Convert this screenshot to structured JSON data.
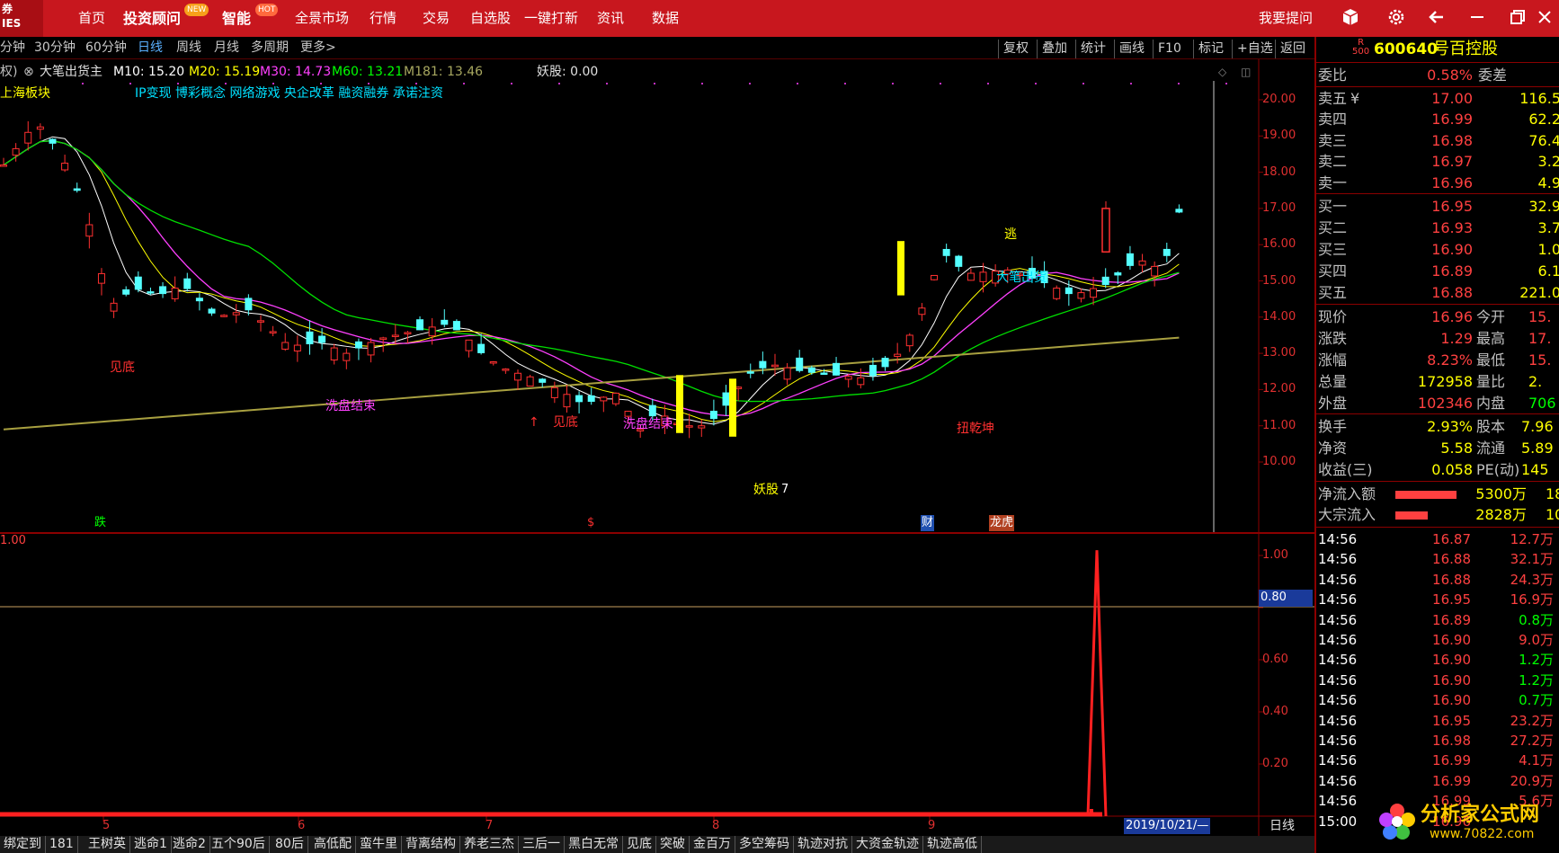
{
  "app": {
    "logo_text": "券\nIES",
    "nav": [
      "首页",
      "投资顾问",
      "智能",
      "全景市场",
      "行情",
      "交易",
      "自选股",
      "一键打新",
      "资讯",
      "数据"
    ],
    "nav_badges": {
      "投资顾问": "NEW",
      "智能": "HOT"
    },
    "ask_label": "我要提问",
    "icons": [
      "cube-icon",
      "gear-icon",
      "back-arrow-icon",
      "minimize-icon",
      "restore-icon",
      "close-icon"
    ]
  },
  "periods": [
    "分钟",
    "30分钟",
    "60分钟",
    "日线",
    "周线",
    "月线",
    "多周期",
    "更多>"
  ],
  "active_period": "日线",
  "tools": [
    "复权",
    "叠加",
    "统计",
    "画线",
    "F10",
    "标记",
    "+自选",
    "返回"
  ],
  "indicator": {
    "prefix": "权)",
    "name": "大笔出货主",
    "ma": [
      {
        "label": "M10: 15.20",
        "color": "#ffffff"
      },
      {
        "label": "M20: 15.19",
        "color": "#ffff00"
      },
      {
        "label": "M30: 14.73",
        "color": "#ff40ff"
      },
      {
        "label": "M60: 13.21",
        "color": "#00ff00"
      },
      {
        "label": "M181: 13.46",
        "color": "#a8a860"
      }
    ],
    "yao_label": "妖股: 0.00",
    "sector": "上海板块",
    "concepts": "IP变现 博彩概念 网络游戏 央企改革 融资融券 承诺注资"
  },
  "price_axis": [
    "20.00",
    "19.00",
    "18.00",
    "17.00",
    "16.00",
    "15.00",
    "14.00",
    "13.00",
    "12.00",
    "11.00",
    "10.00"
  ],
  "lower_axis": [
    "1.00",
    "0.80",
    "0.60",
    "0.40",
    "0.20"
  ],
  "lower_top_value": "1.00",
  "lower_cursor_value": "0.80",
  "annotations": {
    "jiandi1": "见底",
    "xipan1": "洗盘结束",
    "jiandi2": "见底",
    "xipan2": "洗盘结束",
    "yaogu": "妖股",
    "yaogu_num": "7",
    "taopao": "逃",
    "dabi": "大笔出货",
    "niuqian": "扭乾坤",
    "die": "跌",
    "s": "$",
    "cai": "财",
    "longhu": "龙虎"
  },
  "x_labels": [
    "5",
    "6",
    "7",
    "8",
    "9"
  ],
  "date_cursor": "2019/10/21/—",
  "day_label": "日线",
  "bottom_tabs": [
    "绑定到",
    "181",
    "王树英",
    "逃命1",
    "逃命2",
    "五个90后",
    "80后",
    "高低配",
    "蛮牛里",
    "背离结构",
    "养老三杰",
    "三后一",
    "黑白无常",
    "见底",
    "突破",
    "金百万",
    "多空筹码",
    "轨迹对抗",
    "大资金轨迹",
    "轨迹高低"
  ],
  "quote": {
    "code": "600640",
    "name": "号百控股",
    "code_prefix": "R\n500",
    "weibi_label": "委比",
    "weibi": "0.58%",
    "weicha_label": "委差",
    "asks": [
      {
        "label": "卖五",
        "price": "17.00",
        "vol": "116.5"
      },
      {
        "label": "卖四",
        "price": "16.99",
        "vol": "62.2"
      },
      {
        "label": "卖三",
        "price": "16.98",
        "vol": "76.4"
      },
      {
        "label": "卖二",
        "price": "16.97",
        "vol": "3.2"
      },
      {
        "label": "卖一",
        "price": "16.96",
        "vol": "4.9"
      }
    ],
    "ask5_mark": "¥",
    "bids": [
      {
        "label": "买一",
        "price": "16.95",
        "vol": "32.9"
      },
      {
        "label": "买二",
        "price": "16.93",
        "vol": "3.7"
      },
      {
        "label": "买三",
        "price": "16.90",
        "vol": "1.0"
      },
      {
        "label": "买四",
        "price": "16.89",
        "vol": "6.1"
      },
      {
        "label": "买五",
        "price": "16.88",
        "vol": "221.0"
      }
    ],
    "stats": [
      {
        "l1": "现价",
        "v1": "16.96",
        "l2": "今开",
        "v2": "15."
      },
      {
        "l1": "涨跌",
        "v1": "1.29",
        "l2": "最高",
        "v2": "17."
      },
      {
        "l1": "涨幅",
        "v1": "8.23%",
        "l2": "最低",
        "v2": "15."
      },
      {
        "l1": "总量",
        "v1": "172958",
        "l2": "量比",
        "v2": "2."
      },
      {
        "l1": "外盘",
        "v1": "102346",
        "l2": "内盘",
        "v2": "706"
      }
    ],
    "stats2": [
      {
        "l1": "换手",
        "v1": "2.93%",
        "l2": "股本",
        "v2": "7.96"
      },
      {
        "l1": "净资",
        "v1": "5.58",
        "l2": "流通",
        "v2": "5.89"
      },
      {
        "l1": "收益(三)",
        "v1": "0.058",
        "l2": "PE(动)",
        "v2": "145"
      }
    ],
    "flows": [
      {
        "label": "净流入额",
        "value": "5300万",
        "tail": "18"
      },
      {
        "label": "大宗流入",
        "value": "2828万",
        "tail": "10"
      }
    ],
    "ticks": [
      {
        "t": "14:56",
        "p": "16.87",
        "v": "12.7万",
        "c": "#ff4040"
      },
      {
        "t": "14:56",
        "p": "16.88",
        "v": "32.1万",
        "c": "#ff4040"
      },
      {
        "t": "14:56",
        "p": "16.88",
        "v": "24.3万",
        "c": "#ff4040"
      },
      {
        "t": "14:56",
        "p": "16.95",
        "v": "16.9万",
        "c": "#ff4040"
      },
      {
        "t": "14:56",
        "p": "16.89",
        "v": "0.8万",
        "c": "#00ff00"
      },
      {
        "t": "14:56",
        "p": "16.90",
        "v": "9.0万",
        "c": "#ff4040"
      },
      {
        "t": "14:56",
        "p": "16.90",
        "v": "1.2万",
        "c": "#00ff00"
      },
      {
        "t": "14:56",
        "p": "16.90",
        "v": "1.2万",
        "c": "#00ff00"
      },
      {
        "t": "14:56",
        "p": "16.90",
        "v": "0.7万",
        "c": "#00ff00"
      },
      {
        "t": "14:56",
        "p": "16.95",
        "v": "23.2万",
        "c": "#ff4040"
      },
      {
        "t": "14:56",
        "p": "16.98",
        "v": "27.2万",
        "c": "#ff4040"
      },
      {
        "t": "14:56",
        "p": "16.99",
        "v": "4.1万",
        "c": "#ff4040"
      },
      {
        "t": "14:56",
        "p": "16.99",
        "v": "20.9万",
        "c": "#ff4040"
      },
      {
        "t": "14:56",
        "p": "16.99",
        "v": "5.6万",
        "c": "#ff4040"
      },
      {
        "t": "15:00",
        "p": "16.96",
        "v": "",
        "c": "#ff4040"
      }
    ]
  },
  "watermark": {
    "main": "分析家公式网",
    "url": "www.70822.com"
  }
}
